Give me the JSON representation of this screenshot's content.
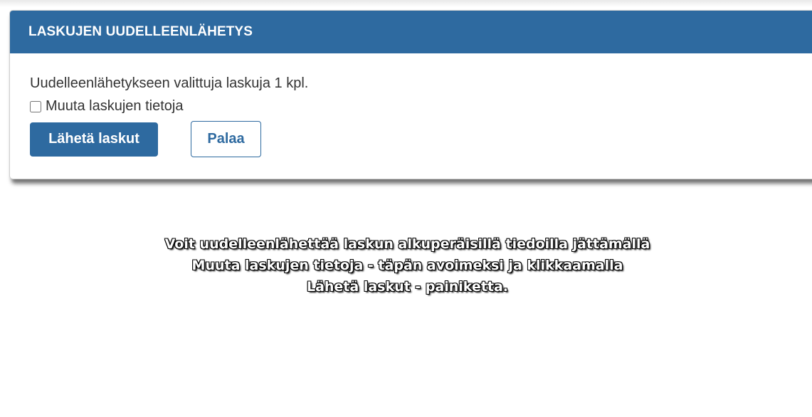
{
  "dialog": {
    "title": "LASKUJEN UUDELLEENLÄHETYS",
    "selected_info": "Uudelleenlähetykseen valittuja laskuja 1 kpl.",
    "checkbox_label": "Muuta laskujen tietoja",
    "checkbox_checked": false,
    "send_button_label": "Lähetä laskut",
    "back_button_label": "Palaa"
  },
  "tutorial": {
    "text": "Voit uudelleenlähettää laskun alkuperäisillä tiedoilla jättämällä\nMuuta laskujen tietoja - täpän avoimeksi ja klikkaamalla\nLähetä laskut - painiketta."
  },
  "colors": {
    "header_bg": "#2e6aa0",
    "primary_button_bg": "#2e6aa0",
    "text": "#333333"
  }
}
